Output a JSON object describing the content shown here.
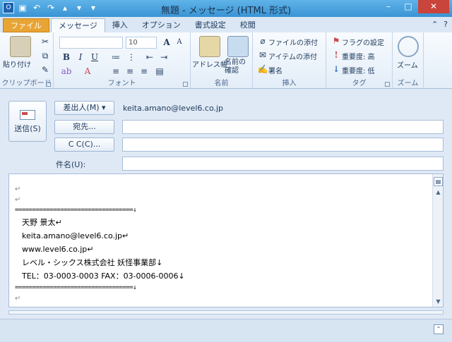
{
  "window": {
    "title": "無題 - メッセージ (HTML 形式)",
    "qat_icons": [
      "outlook-app-icon",
      "save-icon",
      "undo-icon",
      "redo-icon",
      "up-icon",
      "down-icon",
      "customize-qat-icon"
    ]
  },
  "tabs": [
    "ファイル",
    "メッセージ",
    "挿入",
    "オプション",
    "書式設定",
    "校閲"
  ],
  "ribbon": {
    "clipboard": {
      "paste": "貼り付け",
      "label": "クリップボード"
    },
    "font": {
      "font_name": "",
      "font_size": "10",
      "grow": "A",
      "shrink": "A",
      "bold": "B",
      "italic": "I",
      "underline": "U",
      "label": "フォント"
    },
    "names": {
      "address_book": "アドレス帳",
      "check_names": "名前の確認",
      "label": "名前"
    },
    "insert": {
      "attach_file": "ファイルの添付",
      "attach_item": "アイテムの添付",
      "signature": "署名",
      "label": "挿入"
    },
    "tags": {
      "flag": "フラグの設定",
      "high": "重要度: 高",
      "low": "重要度: 低",
      "label": "タグ"
    },
    "zoom": {
      "zoom": "ズーム",
      "label": "ズーム"
    }
  },
  "header": {
    "send_label": "送信(S)",
    "from_button": "差出人(M)",
    "from_value": "keita.amano@level6.co.jp",
    "to_button": "宛先...",
    "cc_button": "C C(C)...",
    "subject_label": "件名(U):",
    "to_value": "",
    "cc_value": "",
    "subject_value": ""
  },
  "body": {
    "mark": "↵",
    "separator": "==================================↓",
    "name": "天野 景太↵",
    "email": "keita.amano@level6.co.jp↵",
    "url": "www.level6.co.jp↵",
    "company": "レベル・シックス株式会社 妖怪事業部↓",
    "phone": "TEL：03-0003-0003 FAX：03-0006-0006↓"
  }
}
